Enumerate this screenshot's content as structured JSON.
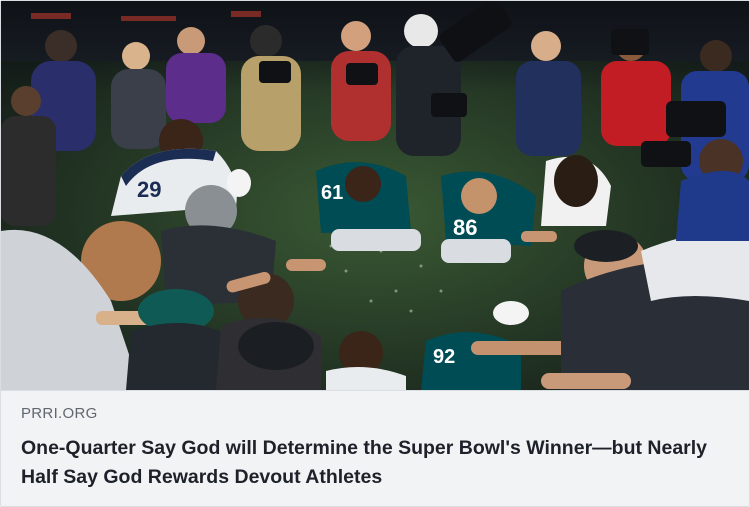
{
  "link_preview": {
    "image_alt": "Players kneeling in prayer on the field surrounded by photographers",
    "domain": "PRRI.ORG",
    "headline": "One-Quarter Say God will Determine the Super Bowl's Winner—but Nearly Half Say God Rewards Devout Athletes",
    "jersey_numbers": [
      "29",
      "61",
      "86",
      "92"
    ]
  },
  "colors": {
    "card_background": "#f2f3f5",
    "card_border": "#dadde1",
    "domain_text": "#606770",
    "headline_text": "#1d2129",
    "eagles_green": "#004c54",
    "patriots_white": "#e9ecef",
    "field_green": "#2e4a2a"
  }
}
